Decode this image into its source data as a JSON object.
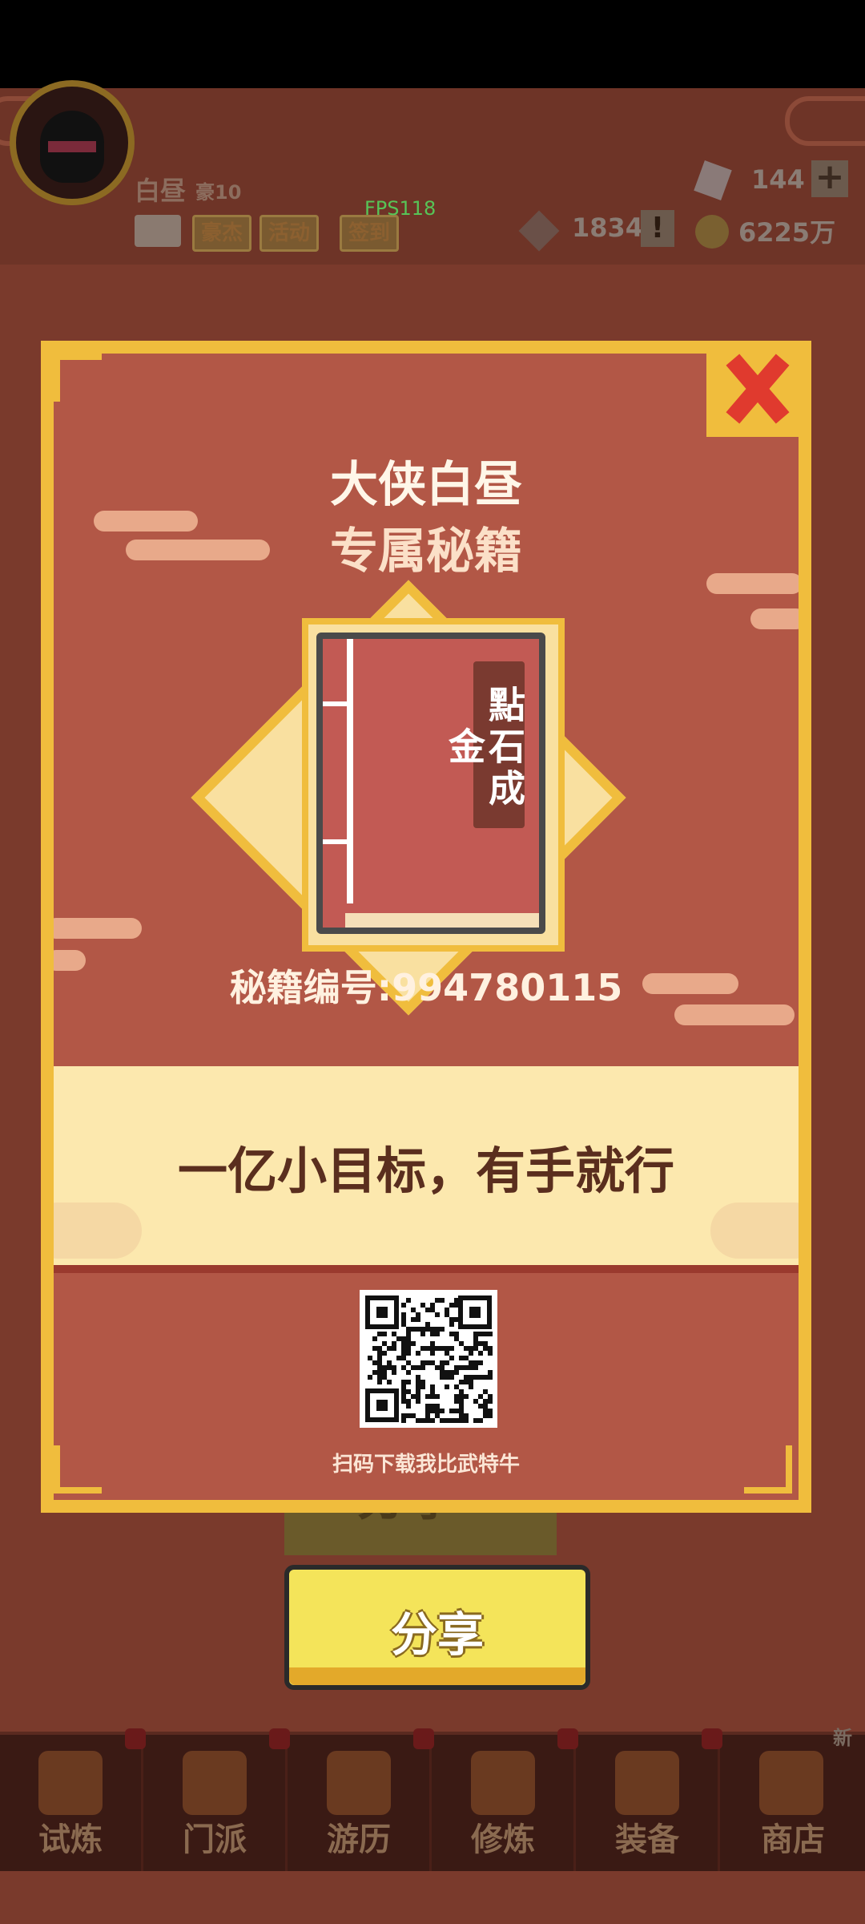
{
  "status_bar": {},
  "background": {
    "player_name": "白昼",
    "player_level": "豪10",
    "fps": "FPS118",
    "top_buttons": [
      {
        "label": "豪杰"
      },
      {
        "label": "活动"
      },
      {
        "label": "签到"
      }
    ],
    "gems": "144",
    "stamina": "1834",
    "gold": "6225万",
    "background_share_label": "分享",
    "nav": [
      {
        "label": "试炼",
        "icon": "trial-icon"
      },
      {
        "label": "门派",
        "icon": "sect-icon"
      },
      {
        "label": "游历",
        "icon": "travel-icon"
      },
      {
        "label": "修炼",
        "icon": "cultivate-icon"
      },
      {
        "label": "装备",
        "icon": "equipment-icon"
      },
      {
        "label": "商店",
        "icon": "shop-icon"
      }
    ],
    "new_badge": "新"
  },
  "dialog": {
    "title_line1": "大侠白昼",
    "title_line2": "专属秘籍",
    "book_title": "點石成金",
    "book_id": "秘籍编号:994780115",
    "slogan": "一亿小目标，有手就行",
    "qr_caption": "扫码下载我比武特牛",
    "close_icon": "close-x-icon"
  },
  "share_button": {
    "label": "分享"
  },
  "colors": {
    "dialog_gold": "#f0bd3d",
    "dialog_red": "#b25746",
    "banner_cream": "#fce8ae",
    "button_yellow": "#f4e45a"
  }
}
